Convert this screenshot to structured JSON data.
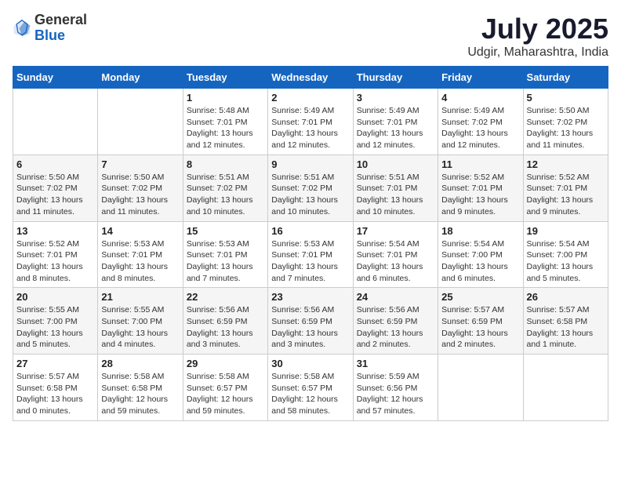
{
  "logo": {
    "general": "General",
    "blue": "Blue"
  },
  "title": "July 2025",
  "subtitle": "Udgir, Maharashtra, India",
  "header": {
    "days": [
      "Sunday",
      "Monday",
      "Tuesday",
      "Wednesday",
      "Thursday",
      "Friday",
      "Saturday"
    ]
  },
  "weeks": [
    [
      {
        "day": "",
        "info": ""
      },
      {
        "day": "",
        "info": ""
      },
      {
        "day": "1",
        "info": "Sunrise: 5:48 AM\nSunset: 7:01 PM\nDaylight: 13 hours and 12 minutes."
      },
      {
        "day": "2",
        "info": "Sunrise: 5:49 AM\nSunset: 7:01 PM\nDaylight: 13 hours and 12 minutes."
      },
      {
        "day": "3",
        "info": "Sunrise: 5:49 AM\nSunset: 7:01 PM\nDaylight: 13 hours and 12 minutes."
      },
      {
        "day": "4",
        "info": "Sunrise: 5:49 AM\nSunset: 7:02 PM\nDaylight: 13 hours and 12 minutes."
      },
      {
        "day": "5",
        "info": "Sunrise: 5:50 AM\nSunset: 7:02 PM\nDaylight: 13 hours and 11 minutes."
      }
    ],
    [
      {
        "day": "6",
        "info": "Sunrise: 5:50 AM\nSunset: 7:02 PM\nDaylight: 13 hours and 11 minutes."
      },
      {
        "day": "7",
        "info": "Sunrise: 5:50 AM\nSunset: 7:02 PM\nDaylight: 13 hours and 11 minutes."
      },
      {
        "day": "8",
        "info": "Sunrise: 5:51 AM\nSunset: 7:02 PM\nDaylight: 13 hours and 10 minutes."
      },
      {
        "day": "9",
        "info": "Sunrise: 5:51 AM\nSunset: 7:02 PM\nDaylight: 13 hours and 10 minutes."
      },
      {
        "day": "10",
        "info": "Sunrise: 5:51 AM\nSunset: 7:01 PM\nDaylight: 13 hours and 10 minutes."
      },
      {
        "day": "11",
        "info": "Sunrise: 5:52 AM\nSunset: 7:01 PM\nDaylight: 13 hours and 9 minutes."
      },
      {
        "day": "12",
        "info": "Sunrise: 5:52 AM\nSunset: 7:01 PM\nDaylight: 13 hours and 9 minutes."
      }
    ],
    [
      {
        "day": "13",
        "info": "Sunrise: 5:52 AM\nSunset: 7:01 PM\nDaylight: 13 hours and 8 minutes."
      },
      {
        "day": "14",
        "info": "Sunrise: 5:53 AM\nSunset: 7:01 PM\nDaylight: 13 hours and 8 minutes."
      },
      {
        "day": "15",
        "info": "Sunrise: 5:53 AM\nSunset: 7:01 PM\nDaylight: 13 hours and 7 minutes."
      },
      {
        "day": "16",
        "info": "Sunrise: 5:53 AM\nSunset: 7:01 PM\nDaylight: 13 hours and 7 minutes."
      },
      {
        "day": "17",
        "info": "Sunrise: 5:54 AM\nSunset: 7:01 PM\nDaylight: 13 hours and 6 minutes."
      },
      {
        "day": "18",
        "info": "Sunrise: 5:54 AM\nSunset: 7:00 PM\nDaylight: 13 hours and 6 minutes."
      },
      {
        "day": "19",
        "info": "Sunrise: 5:54 AM\nSunset: 7:00 PM\nDaylight: 13 hours and 5 minutes."
      }
    ],
    [
      {
        "day": "20",
        "info": "Sunrise: 5:55 AM\nSunset: 7:00 PM\nDaylight: 13 hours and 5 minutes."
      },
      {
        "day": "21",
        "info": "Sunrise: 5:55 AM\nSunset: 7:00 PM\nDaylight: 13 hours and 4 minutes."
      },
      {
        "day": "22",
        "info": "Sunrise: 5:56 AM\nSunset: 6:59 PM\nDaylight: 13 hours and 3 minutes."
      },
      {
        "day": "23",
        "info": "Sunrise: 5:56 AM\nSunset: 6:59 PM\nDaylight: 13 hours and 3 minutes."
      },
      {
        "day": "24",
        "info": "Sunrise: 5:56 AM\nSunset: 6:59 PM\nDaylight: 13 hours and 2 minutes."
      },
      {
        "day": "25",
        "info": "Sunrise: 5:57 AM\nSunset: 6:59 PM\nDaylight: 13 hours and 2 minutes."
      },
      {
        "day": "26",
        "info": "Sunrise: 5:57 AM\nSunset: 6:58 PM\nDaylight: 13 hours and 1 minute."
      }
    ],
    [
      {
        "day": "27",
        "info": "Sunrise: 5:57 AM\nSunset: 6:58 PM\nDaylight: 13 hours and 0 minutes."
      },
      {
        "day": "28",
        "info": "Sunrise: 5:58 AM\nSunset: 6:58 PM\nDaylight: 12 hours and 59 minutes."
      },
      {
        "day": "29",
        "info": "Sunrise: 5:58 AM\nSunset: 6:57 PM\nDaylight: 12 hours and 59 minutes."
      },
      {
        "day": "30",
        "info": "Sunrise: 5:58 AM\nSunset: 6:57 PM\nDaylight: 12 hours and 58 minutes."
      },
      {
        "day": "31",
        "info": "Sunrise: 5:59 AM\nSunset: 6:56 PM\nDaylight: 12 hours and 57 minutes."
      },
      {
        "day": "",
        "info": ""
      },
      {
        "day": "",
        "info": ""
      }
    ]
  ]
}
